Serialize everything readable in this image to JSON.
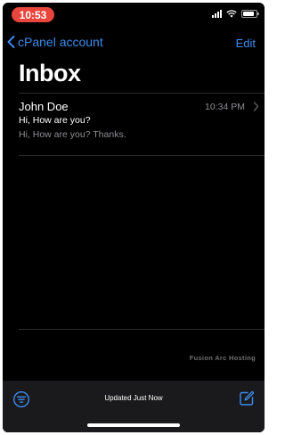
{
  "status_bar": {
    "time": "10:53",
    "battery_level": 0.85
  },
  "nav": {
    "back_label": "cPanel account",
    "edit_label": "Edit"
  },
  "title": "Inbox",
  "messages": [
    {
      "sender": "John Doe",
      "time": "10:34 PM",
      "subject": "Hi, How are you?",
      "preview": "Hi, How are you? Thanks."
    }
  ],
  "watermark": "Fusion Arc Hosting",
  "toolbar": {
    "status": "Updated Just Now",
    "filter_icon": "filter-icon",
    "compose_icon": "compose-icon"
  },
  "colors": {
    "accent": "#3d8cf0",
    "time_pill": "#e8453c",
    "background": "#000000",
    "secondary_text": "#8e8e93"
  }
}
